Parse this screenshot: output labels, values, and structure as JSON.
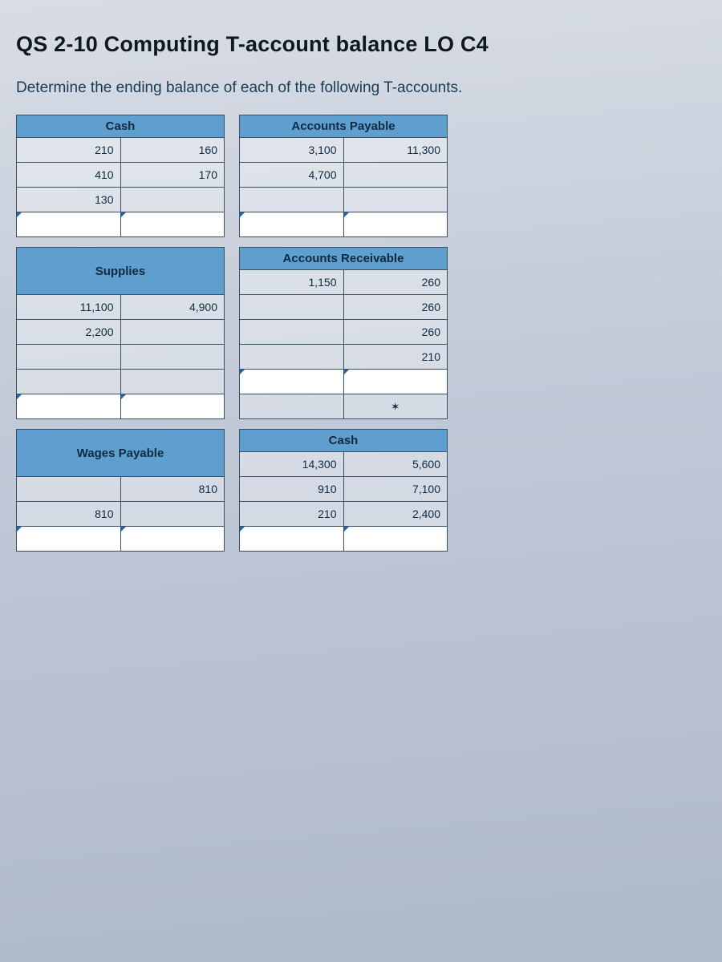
{
  "title": "QS 2-10 Computing T-account balance LO C4",
  "prompt": "Determine the ending balance of each of the following T-accounts.",
  "accounts": [
    {
      "name": "Cash",
      "rows": [
        {
          "debit": "210",
          "credit": "160"
        },
        {
          "debit": "410",
          "credit": "170"
        },
        {
          "debit": "130",
          "credit": ""
        }
      ]
    },
    {
      "name": "Accounts Payable",
      "rows": [
        {
          "debit": "3,100",
          "credit": "11,300"
        },
        {
          "debit": "4,700",
          "credit": ""
        },
        {
          "debit": "",
          "credit": ""
        }
      ]
    },
    {
      "name": "Supplies",
      "rows": [
        {
          "debit": "11,100",
          "credit": "4,900"
        },
        {
          "debit": "2,200",
          "credit": ""
        },
        {
          "debit": "",
          "credit": ""
        },
        {
          "debit": "",
          "credit": ""
        }
      ]
    },
    {
      "name": "Accounts Receivable",
      "rows": [
        {
          "debit": "1,150",
          "credit": "260"
        },
        {
          "debit": "",
          "credit": "260"
        },
        {
          "debit": "",
          "credit": "260"
        },
        {
          "debit": "",
          "credit": "210"
        }
      ],
      "star": true
    },
    {
      "name": "Wages Payable",
      "rows": [
        {
          "debit": "",
          "credit": "810"
        },
        {
          "debit": "810",
          "credit": ""
        }
      ]
    },
    {
      "name": "Cash",
      "rows": [
        {
          "debit": "14,300",
          "credit": "5,600"
        },
        {
          "debit": "910",
          "credit": "7,100"
        },
        {
          "debit": "210",
          "credit": "2,400"
        }
      ]
    }
  ]
}
